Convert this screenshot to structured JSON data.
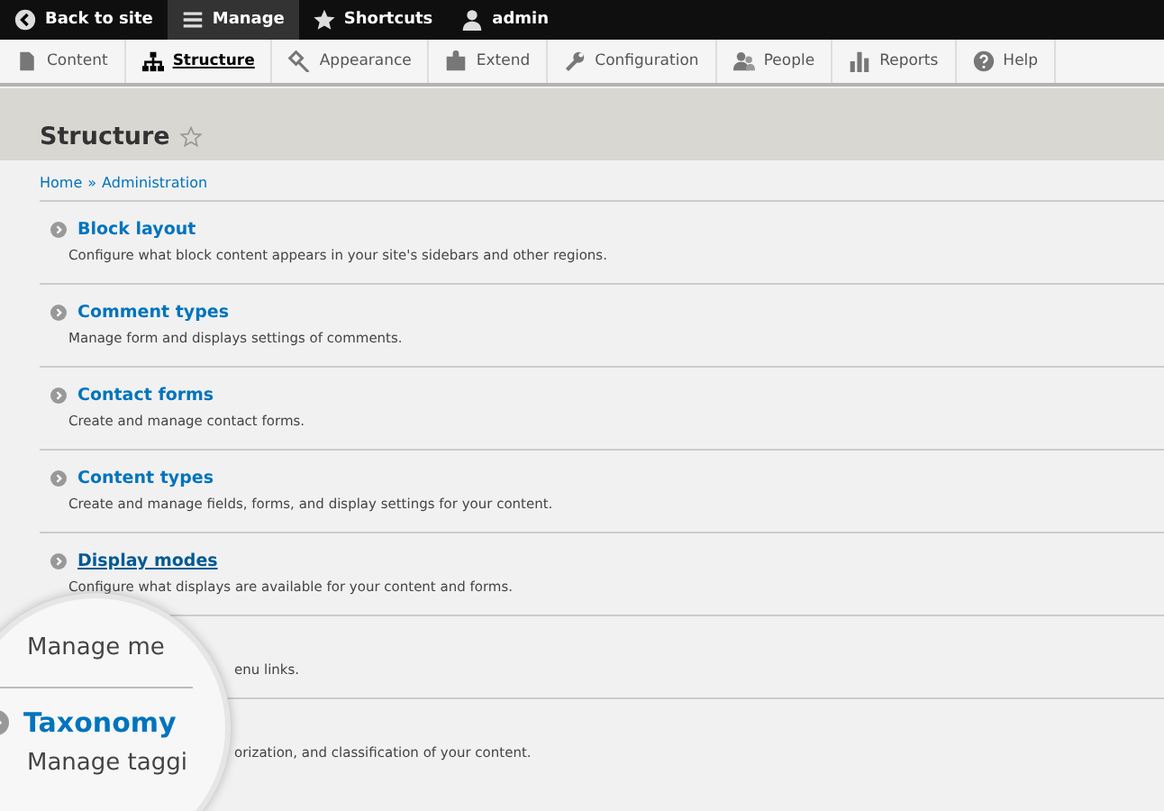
{
  "toolbar": [
    {
      "label": "Back to site",
      "selected": false
    },
    {
      "label": "Manage",
      "selected": true
    },
    {
      "label": "Shortcuts",
      "selected": false
    },
    {
      "label": "admin",
      "selected": false
    }
  ],
  "tabs": [
    {
      "label": "Content",
      "selected": false
    },
    {
      "label": "Structure",
      "selected": true
    },
    {
      "label": "Appearance",
      "selected": false
    },
    {
      "label": "Extend",
      "selected": false
    },
    {
      "label": "Configuration",
      "selected": false
    },
    {
      "label": "People",
      "selected": false
    },
    {
      "label": "Reports",
      "selected": false
    },
    {
      "label": "Help",
      "selected": false
    }
  ],
  "page_title": "Structure",
  "breadcrumb": [
    "Home",
    "Administration"
  ],
  "breadcrumb_separator": "»",
  "items": [
    {
      "title": "Block layout",
      "description": "Configure what block content appears in your site's sidebars and other regions.",
      "hovered": false
    },
    {
      "title": "Comment types",
      "description": "Manage form and displays settings of comments.",
      "hovered": false
    },
    {
      "title": "Contact forms",
      "description": "Create and manage contact forms.",
      "hovered": false
    },
    {
      "title": "Content types",
      "description": "Create and manage fields, forms, and display settings for your content.",
      "hovered": false
    },
    {
      "title": "Display modes",
      "description": "Configure what displays are available for your content and forms.",
      "hovered": true
    },
    {
      "description": "enu links."
    },
    {
      "description": "orization, and classification of your content."
    }
  ],
  "magnifier": {
    "lines": [
      {
        "kind": "description",
        "text": "Manage me"
      },
      {
        "kind": "title",
        "text": "Taxonomy"
      },
      {
        "kind": "description",
        "text": "Manage taggi"
      }
    ]
  }
}
